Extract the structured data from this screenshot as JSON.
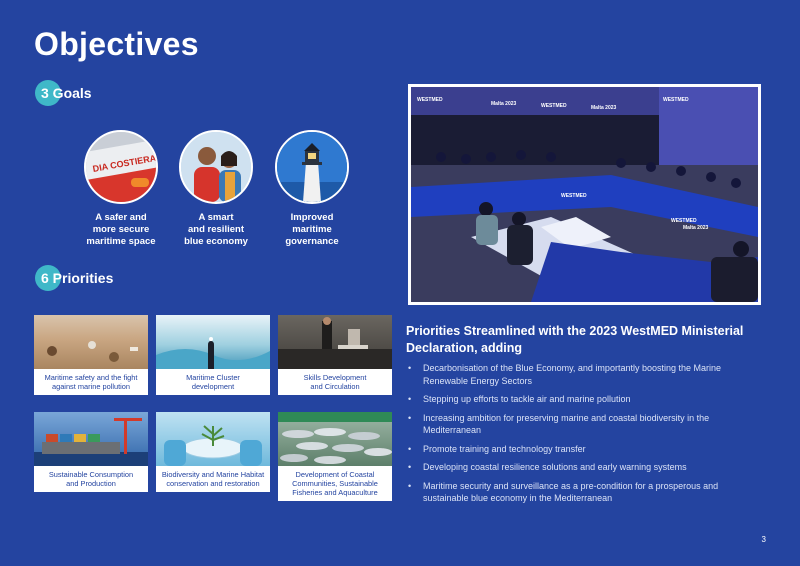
{
  "title": "Objectives",
  "goals_heading": "3 Goals",
  "goals": [
    {
      "label_lines": [
        "A safer and",
        "more secure",
        "maritime space"
      ],
      "image_text": "DIA COSTIERA"
    },
    {
      "label_lines": [
        "A smart",
        "and resilient",
        "blue economy"
      ]
    },
    {
      "label_lines": [
        "Improved",
        "maritime",
        "governance"
      ]
    }
  ],
  "priorities_heading": "6 Priorities",
  "priorities": [
    {
      "caption_lines": [
        "Maritime safety and the fight",
        "against marine pollution"
      ]
    },
    {
      "caption_lines": [
        "Maritime Cluster",
        "development"
      ]
    },
    {
      "caption_lines": [
        "Skills Development",
        "and Circulation"
      ]
    },
    {
      "caption_lines": [
        "Sustainable Consumption",
        "and Production"
      ]
    },
    {
      "caption_lines": [
        "Biodiversity and Marine Habitat",
        "conservation and restoration"
      ]
    },
    {
      "caption_lines": [
        "Development of Coastal",
        "Communities, Sustainable",
        "Fisheries and Aquaculture"
      ]
    }
  ],
  "photo_banners": [
    "WESTMED",
    "Malta 2023",
    "WESTMED",
    "Malta 2023",
    "WESTMED"
  ],
  "photo_table_labels": [
    "WESTMED",
    "WESTMED",
    "Malta 2023"
  ],
  "declaration_title_lines": [
    "Priorities Streamlined with the 2023 WestMED Ministerial",
    "Declaration, adding"
  ],
  "bullets": [
    {
      "lines": [
        "Decarbonisation of the Blue Economy, and importantly boosting the Marine",
        "Renewable Energy Sectors"
      ]
    },
    {
      "lines": [
        "Stepping up efforts to tackle air and marine pollution"
      ]
    },
    {
      "lines": [
        "Increasing ambition for preserving marine and coastal biodiversity in the",
        "Mediterranean"
      ]
    },
    {
      "lines": [
        "Promote training and technology transfer"
      ]
    },
    {
      "lines": [
        "Developing coastal resilience solutions and early warning systems"
      ]
    },
    {
      "lines": [
        "Maritime security and surveillance as a pre-condition for a prosperous and",
        "sustainable blue economy in the Mediterranean"
      ]
    }
  ],
  "bullet_symbol": "•",
  "page_number": "3",
  "colors": {
    "background": "#2444a0",
    "accent_dot": "#3fb8c8",
    "caption_text": "#2444a0"
  }
}
